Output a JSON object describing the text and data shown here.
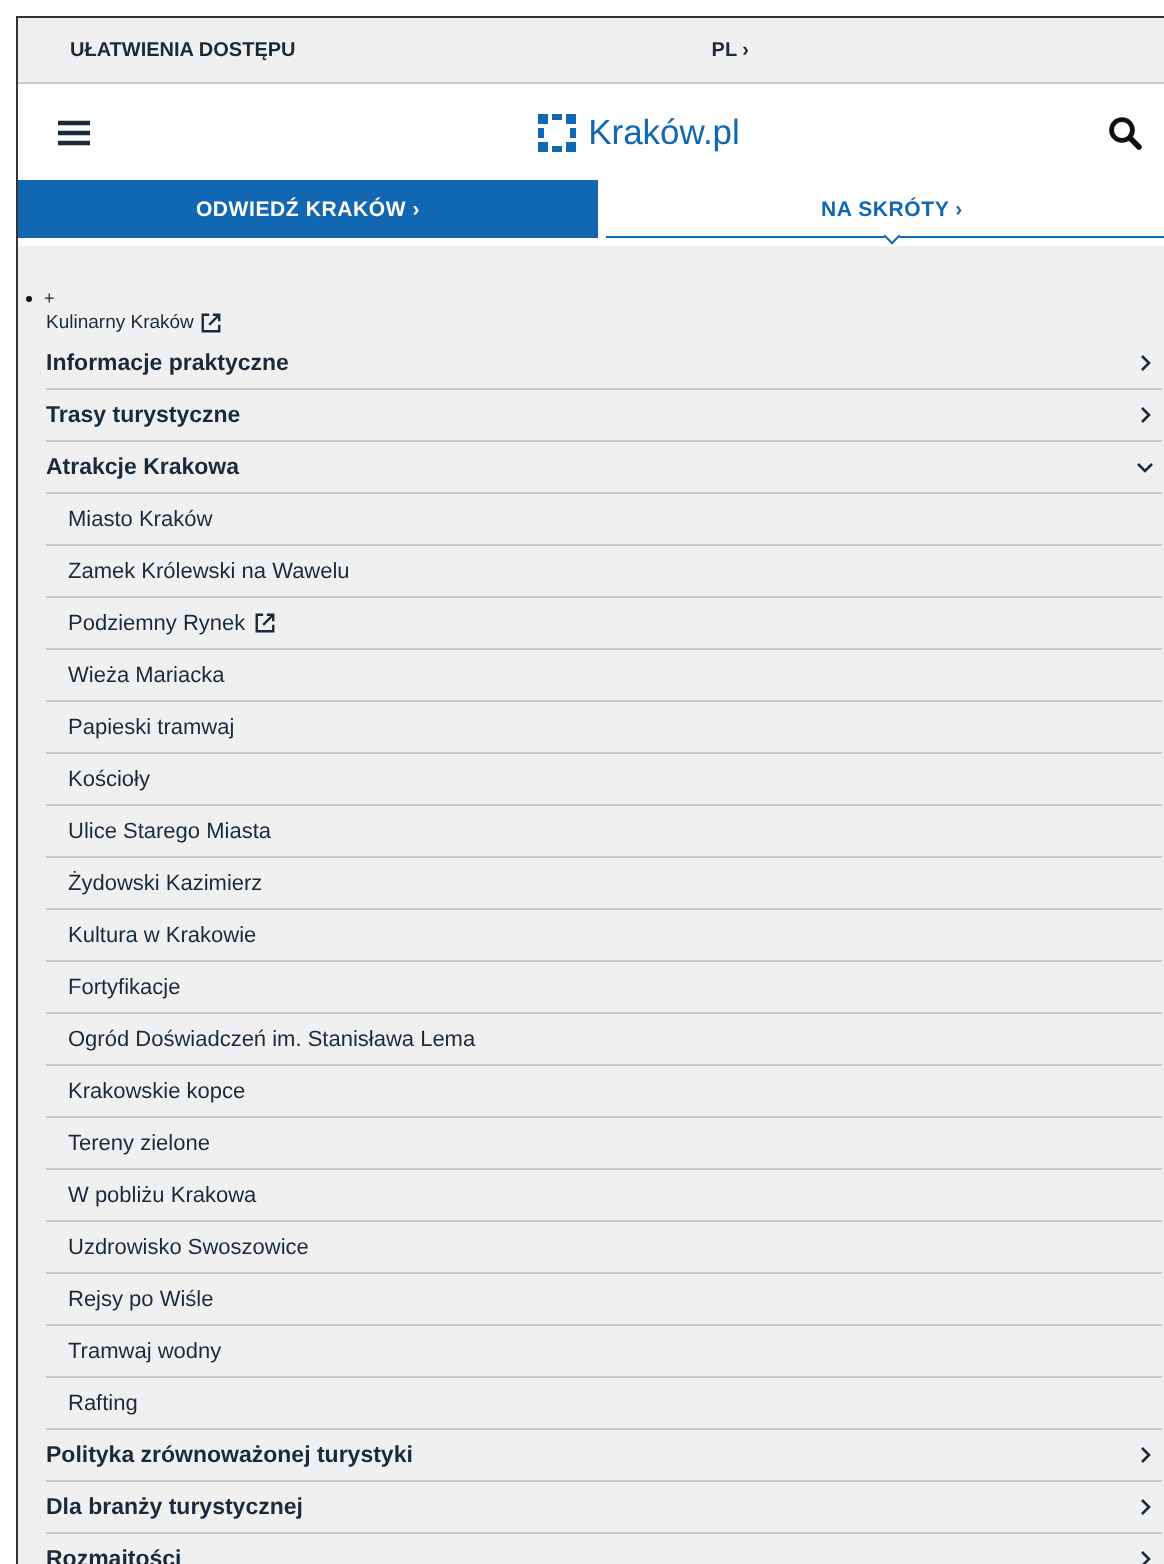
{
  "top_bar": {
    "accessibility": "UŁATWIENIA DOSTĘPU",
    "language": "PL ›"
  },
  "header": {
    "logo_text": "Kraków.pl"
  },
  "tabs": [
    {
      "label": "ODWIEDŹ KRAKÓW ›",
      "selected": false
    },
    {
      "label": "NA SKRÓTY ›",
      "selected": true
    }
  ],
  "menu": {
    "bullet": "+",
    "link": {
      "label": "Kulinarny Kraków",
      "external": true
    },
    "items": [
      {
        "label": "Informacje praktyczne",
        "expanded": false
      },
      {
        "label": "Trasy turystyczne",
        "expanded": false
      },
      {
        "label": "Atrakcje Krakowa",
        "expanded": true,
        "children": [
          {
            "label": "Miasto Kraków",
            "external": false
          },
          {
            "label": "Zamek Królewski na Wawelu",
            "external": false
          },
          {
            "label": "Podziemny Rynek",
            "external": true
          },
          {
            "label": "Wieża Mariacka",
            "external": false
          },
          {
            "label": "Papieski tramwaj",
            "external": false
          },
          {
            "label": "Kościoły",
            "external": false
          },
          {
            "label": "Ulice Starego Miasta",
            "external": false
          },
          {
            "label": "Żydowski Kazimierz",
            "external": false
          },
          {
            "label": "Kultura w Krakowie",
            "external": false
          },
          {
            "label": "Fortyfikacje",
            "external": false
          },
          {
            "label": "Ogród Doświadczeń im. Stanisława Lema",
            "external": false
          },
          {
            "label": "Krakowskie kopce",
            "external": false
          },
          {
            "label": "Tereny zielone",
            "external": false
          },
          {
            "label": "W pobliżu Krakowa",
            "external": false
          },
          {
            "label": "Uzdrowisko Swoszowice",
            "external": false
          },
          {
            "label": "Rejsy po Wiśle",
            "external": false
          },
          {
            "label": "Tramwaj wodny",
            "external": false
          },
          {
            "label": "Rafting",
            "external": false
          }
        ]
      },
      {
        "label": "Polityka zrównoważonej turystyki",
        "expanded": false
      },
      {
        "label": "Dla branży turystycznej",
        "expanded": false
      },
      {
        "label": "Rozmaitości",
        "expanded": false
      }
    ]
  }
}
